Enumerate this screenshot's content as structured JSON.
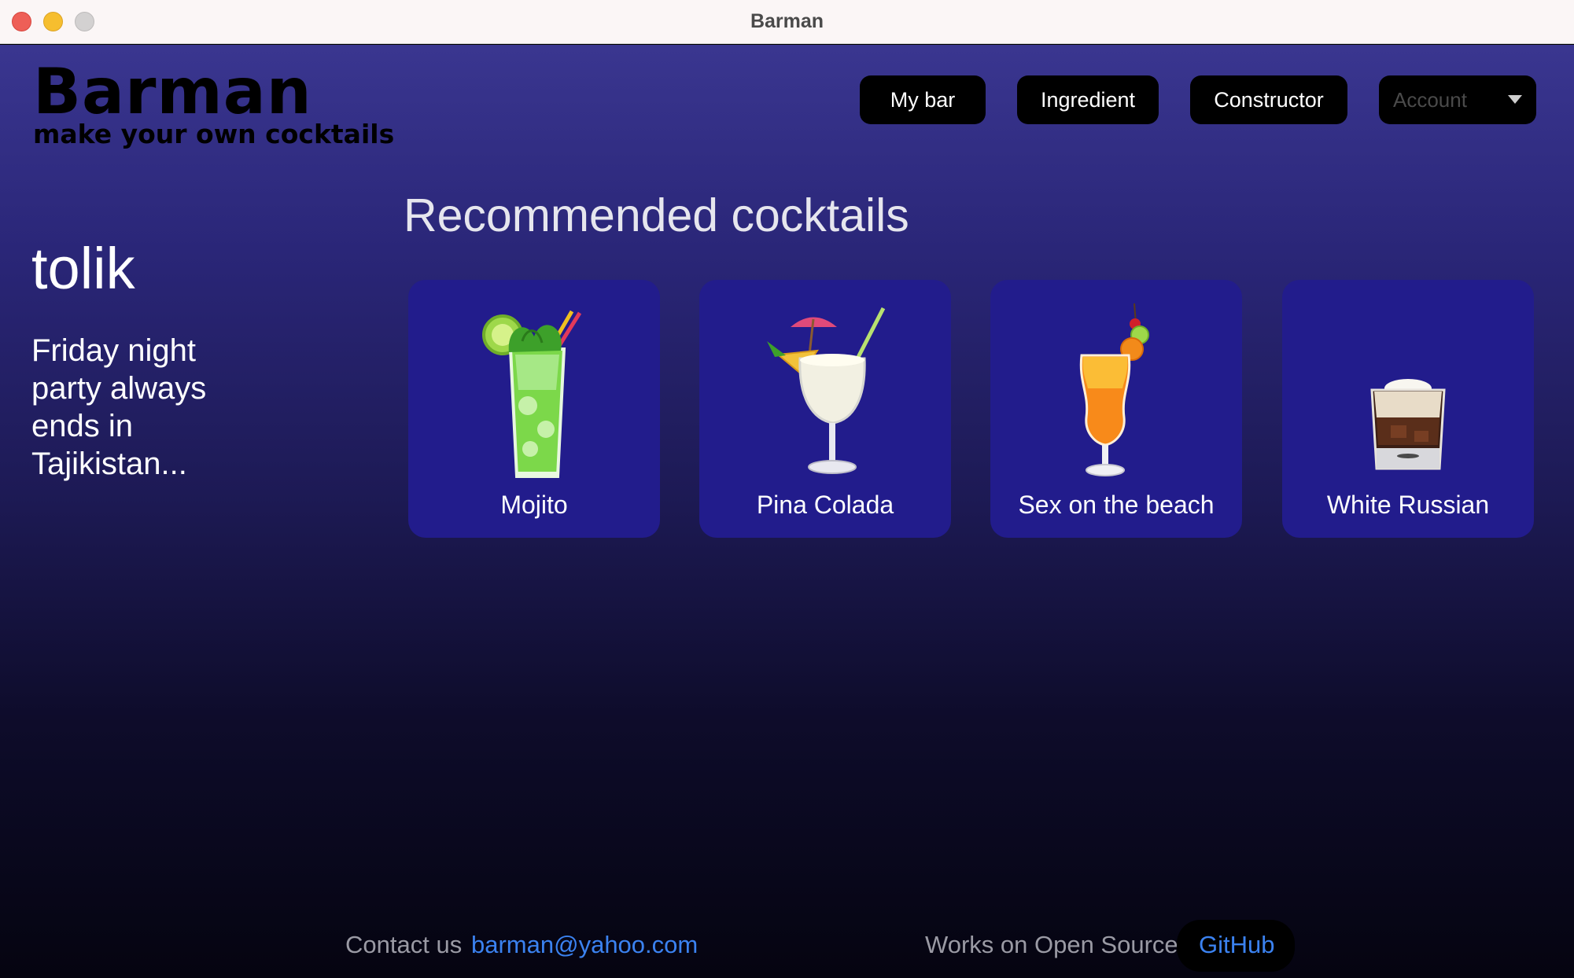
{
  "window": {
    "title": "Barman"
  },
  "header": {
    "logo_title": "Barman",
    "logo_subtitle": "make your own cocktails",
    "nav": {
      "my_bar": "My bar",
      "ingredient": "Ingredient",
      "constructor": "Constructor"
    },
    "account": {
      "placeholder": "Account",
      "icon": "chevron-down-icon"
    }
  },
  "profile": {
    "username": "tolik",
    "bio": "Friday night party always ends in Tajikistan..."
  },
  "main": {
    "section_title": "Recommended cocktails",
    "cocktails": [
      {
        "name": "Mojito",
        "icon": "mojito-glass-icon"
      },
      {
        "name": "Pina Colada",
        "icon": "pina-colada-glass-icon"
      },
      {
        "name": "Sex on the beach",
        "icon": "hurricane-glass-icon"
      },
      {
        "name": "White Russian",
        "icon": "lowball-glass-icon"
      }
    ]
  },
  "footer": {
    "contact_label": "Contact us",
    "contact_email": "barman@yahoo.com",
    "opensource_label": "Works on Open Source",
    "github_label": "GitHub"
  },
  "colors": {
    "accent_link": "#3b82f0",
    "card_bg": "#221c8c",
    "button_bg": "#000000"
  }
}
